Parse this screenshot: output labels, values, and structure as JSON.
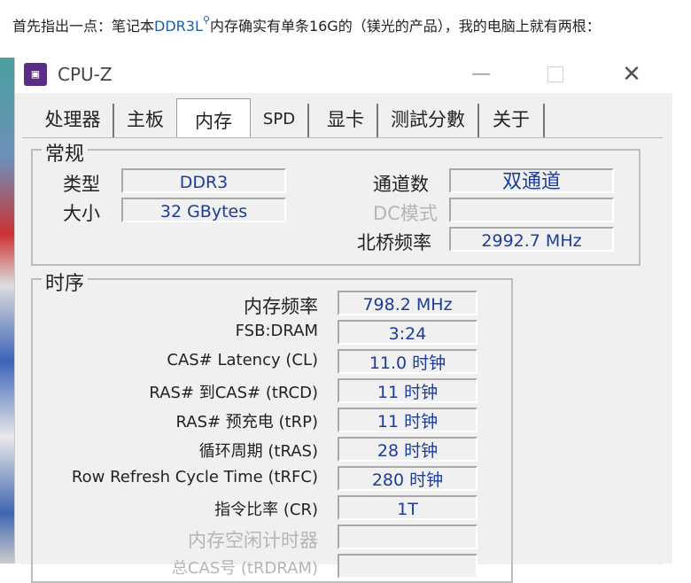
{
  "article": {
    "prefix": "首先指出一点：笔记本",
    "keyword": "DDR3L",
    "keyword_icon": "search-icon",
    "suffix": "内存确实有单条16G的（镁光的产品），我的电脑上就有两根："
  },
  "window": {
    "title": "CPU-Z",
    "icon": "cpuz-icon",
    "min_glyph": "—",
    "close_glyph": "✕",
    "tabs": [
      {
        "label": "处理器",
        "active": false
      },
      {
        "label": "主板",
        "active": false
      },
      {
        "label": "内存",
        "active": true
      },
      {
        "label": "SPD",
        "active": false
      },
      {
        "label": "显卡",
        "active": false
      },
      {
        "label": "测試分數",
        "active": false
      },
      {
        "label": "关于",
        "active": false
      }
    ]
  },
  "general": {
    "title": "常规",
    "type_label": "类型",
    "type_value": "DDR3",
    "size_label": "大小",
    "size_value": "32 GBytes",
    "channels_label": "通道数",
    "channels_value": "双通道",
    "dc_label": "DC模式",
    "dc_value": "",
    "nb_label": "北桥频率",
    "nb_value": "2992.7 MHz"
  },
  "timings": {
    "title": "时序",
    "rows": [
      {
        "label": "内存频率",
        "value": "798.2 MHz",
        "dim": false
      },
      {
        "label": "FSB:DRAM",
        "value": "3:24",
        "dim": false
      },
      {
        "label": "CAS# Latency (CL)",
        "value": "11.0 时钟",
        "dim": false
      },
      {
        "label": "RAS# 到CAS# (tRCD)",
        "value": "11 时钟",
        "dim": false
      },
      {
        "label": "RAS# 预充电 (tRP)",
        "value": "11 时钟",
        "dim": false
      },
      {
        "label": "循环周期 (tRAS)",
        "value": "28 时钟",
        "dim": false
      },
      {
        "label": "Row Refresh Cycle Time (tRFC)",
        "value": "280 时钟",
        "dim": false
      },
      {
        "label": "指令比率 (CR)",
        "value": "1T",
        "dim": false
      },
      {
        "label": "内存空闲计时器",
        "value": "",
        "dim": true
      },
      {
        "label": "总CAS号 (tRDRAM)",
        "value": "",
        "dim": true
      }
    ]
  },
  "colors": {
    "value_text": "#1c3d9a",
    "window_bg": "#f0f0f0",
    "icon_bg": "#5a2c86",
    "link": "#1f5ea8"
  }
}
